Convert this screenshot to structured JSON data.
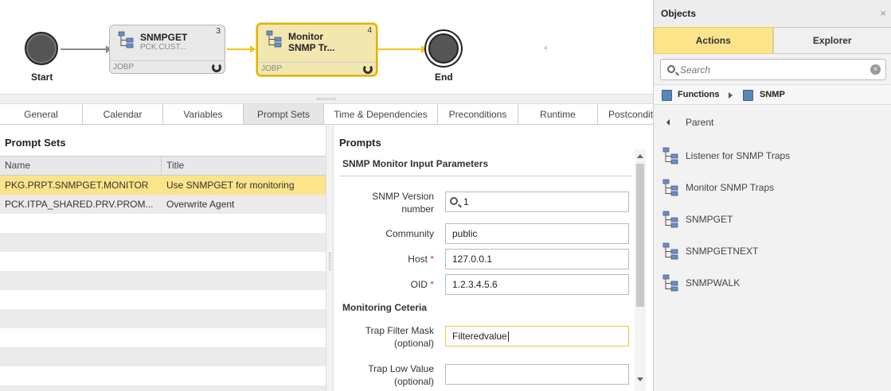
{
  "workflow": {
    "start_label": "Start",
    "end_label": "End",
    "plus": "+",
    "jobs": [
      {
        "title": "SNMPGET",
        "subtitle": "PCK.CUST...",
        "type": "JOBP",
        "number": "3"
      },
      {
        "title": "Monitor",
        "title2": "SNMP Tr...",
        "type": "JOBP",
        "number": "4"
      }
    ],
    "colors": {
      "active_border": "#e0b300",
      "arrow_gray": "#888888",
      "arrow_yellow": "#f0c419"
    }
  },
  "tabs": [
    {
      "label": "General"
    },
    {
      "label": "Calendar"
    },
    {
      "label": "Variables"
    },
    {
      "label": "Prompt Sets"
    },
    {
      "label": "Time & Dependencies"
    },
    {
      "label": "Preconditions"
    },
    {
      "label": "Runtime"
    },
    {
      "label": "Postcondit"
    }
  ],
  "prompt_sets": {
    "heading": "Prompt Sets",
    "columns": [
      "Name",
      "Title"
    ],
    "rows": [
      {
        "name": "PKG.PRPT.SNMPGET.MONITOR",
        "title": "Use SNMPGET for monitoring"
      },
      {
        "name": "PCK.ITPA_SHARED.PRV.PROM...",
        "title": "Overwrite Agent"
      }
    ]
  },
  "prompts": {
    "heading": "Prompts",
    "section1": "SNMP Monitor Input Parameters",
    "section2": "Monitoring Ceteria",
    "fields": {
      "snmp_version": {
        "label1": "SNMP Version",
        "label2": "number",
        "value": "1"
      },
      "community": {
        "label": "Community",
        "value": "public"
      },
      "host": {
        "label": "Host",
        "required": "*",
        "value": "127.0.0.1"
      },
      "oid": {
        "label": "OID",
        "required": "*",
        "value": "1.2.3.4.5.6"
      },
      "trap_filter": {
        "label1": "Trap Filter Mask",
        "label2": "(optional)",
        "value": "Filteredvalue"
      },
      "trap_low": {
        "label1": "Trap Low Value",
        "label2": "(optional)",
        "value": ""
      }
    }
  },
  "objects": {
    "title": "Objects",
    "close": "×",
    "tabs": [
      "Actions",
      "Explorer"
    ],
    "search_placeholder": "Search",
    "clear": "×",
    "breadcrumb": [
      "Functions",
      "SNMP"
    ],
    "parent_label": "Parent",
    "items": [
      {
        "label": "Listener for SNMP Traps"
      },
      {
        "label": "Monitor SNMP Traps"
      },
      {
        "label": "SNMPGET"
      },
      {
        "label": "SNMPGETNEXT"
      },
      {
        "label": "SNMPWALK"
      }
    ]
  }
}
